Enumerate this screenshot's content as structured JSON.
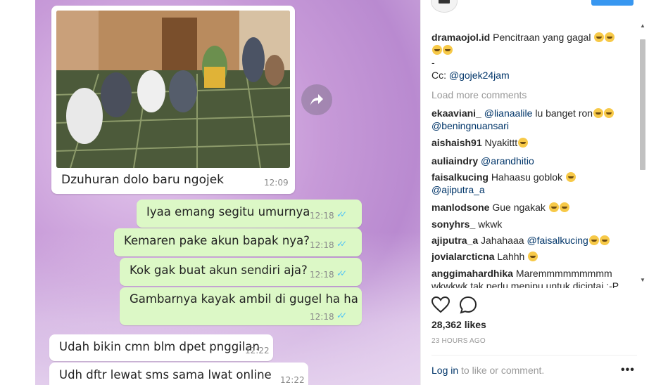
{
  "post": {
    "chat": {
      "image_caption": "Dzuhuran dolo baru ngojek",
      "image_time": "12:09",
      "messages": [
        {
          "text": "Iyaa emang segitu umurnya",
          "time": "12:18",
          "dir": "out"
        },
        {
          "text": "Kemaren pake akun bapak nya?",
          "time": "12:18",
          "dir": "out"
        },
        {
          "text": "Kok gak buat akun sendiri aja?",
          "time": "12:18",
          "dir": "out"
        },
        {
          "text": "Gambarnya kayak ambil di gugel ha ha",
          "time": "12:18",
          "dir": "out"
        },
        {
          "text": "Udah bikin cmn blm dpet pnggilan",
          "time": "12:22",
          "dir": "in"
        },
        {
          "text": "Udh dftr lewat sms sama lwat online",
          "time": "12:22",
          "dir": "in"
        }
      ]
    }
  },
  "header": {
    "username": "dramaojol.id",
    "follow_label": ""
  },
  "caption": {
    "user": "dramaojol.id",
    "text": "Pencitraan yang gagal",
    "dash": "-",
    "cc_prefix": "Cc:",
    "cc_mention": "@gojek24jam"
  },
  "load_more": "Load more comments",
  "comments": [
    {
      "user": "ekaaviani_",
      "mention": "@lianaalile",
      "text": "lu banget ron",
      "line2": "@beningnuansari"
    },
    {
      "user": "aishaish91",
      "text": "Nyakittt"
    },
    {
      "user": "auliaindry",
      "mention": "@arandhitio",
      "text": ""
    },
    {
      "user": "faisalkucing",
      "text": "Hahaasu goblok",
      "line2": "@ajiputra_a"
    },
    {
      "user": "manlodsone",
      "text": "Gue ngakak"
    },
    {
      "user": "sonyhrs_",
      "text": "wkwk"
    },
    {
      "user": "ajiputra_a",
      "text": "Jahahaaa",
      "mention": "@faisalkucing"
    },
    {
      "user": "jovialarcticna",
      "text": "Lahhh"
    },
    {
      "user": "anggimahardhika",
      "text": "Marem\u0000mmmmmmm",
      "line2": "wkwkwk tak perlu menipu untuk dicintai :-P"
    }
  ],
  "likes": "28,362 likes",
  "time_ago": "23 HOURS AGO",
  "login": {
    "link": "Log in",
    "rest": "to like or comment."
  },
  "icons": {
    "like": "heart-icon",
    "comment": "comment-icon",
    "share": "share-icon",
    "more": "more-options-icon"
  },
  "colors": {
    "accent": "#3897f0",
    "bubble_out": "#dcf8c6",
    "mention": "#003569"
  }
}
